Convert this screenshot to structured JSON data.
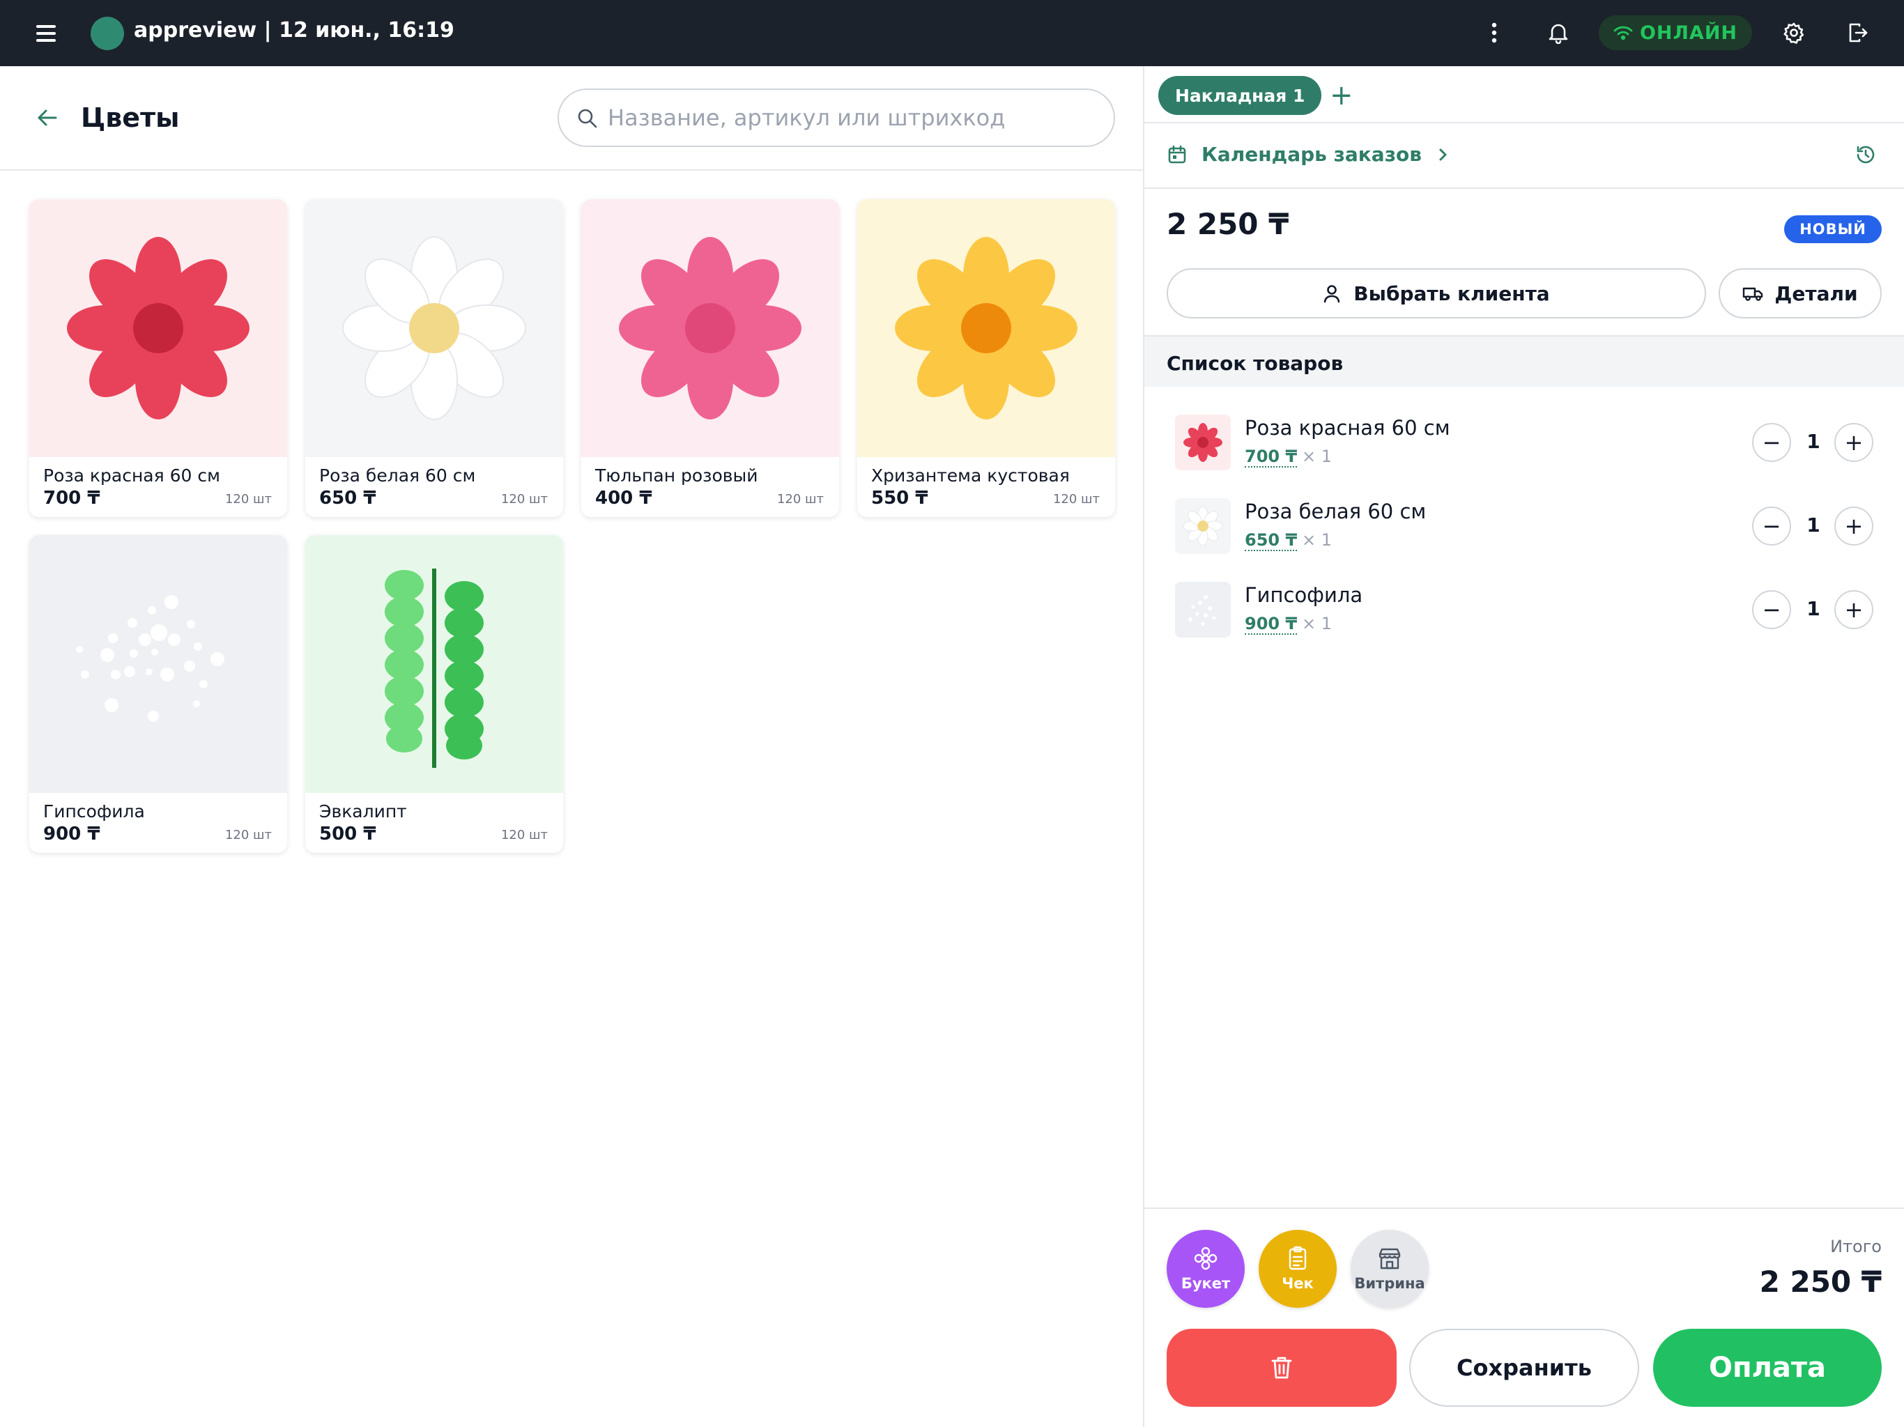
{
  "topbar": {
    "app_title": "appreview | 12 июн., 16:19",
    "online_label": "ОНЛАЙН",
    "icons": [
      "menu-icon",
      "more-vertical-icon",
      "bell-icon",
      "wifi-icon",
      "gear-icon",
      "logout-icon"
    ]
  },
  "catalog": {
    "title": "Цветы",
    "search_placeholder": "Название, артикул или штрихкод",
    "search_value": "",
    "products": [
      {
        "name": "Роза красная 60 см",
        "price": "700 ₸",
        "stock": "120 шт",
        "bg": "#fdecee",
        "petal": "#e8425a",
        "center": "#c5253b"
      },
      {
        "name": "Роза белая 60 см",
        "price": "650 ₸",
        "stock": "120 шт",
        "bg": "#f4f5f7",
        "petal": "#ffffff",
        "center": "#f2d98a"
      },
      {
        "name": "Тюльпан розовый",
        "price": "400 ₸",
        "stock": "120 шт",
        "bg": "#fdecf1",
        "petal": "#ef6392",
        "center": "#e0487a"
      },
      {
        "name": "Хризантема кустовая",
        "price": "550 ₸",
        "stock": "120 шт",
        "bg": "#fdf6d8",
        "petal": "#fcc844",
        "center": "#ee8a0b"
      },
      {
        "name": "Гипсофила",
        "price": "900 ₸",
        "stock": "120 шт",
        "bg": "#eef0f4"
      },
      {
        "name": "Эвкалипт",
        "price": "500 ₸",
        "stock": "120 шт",
        "bg": "#e7f8ea"
      }
    ]
  },
  "order": {
    "tab_label": "Накладная 1",
    "calendar_label": "Календарь заказов",
    "total": "2 250 ₸",
    "status": "НОВЫЙ",
    "client_button": "Выбрать клиента",
    "details_button": "Детали",
    "list_title": "Список товаров",
    "items": [
      {
        "name": "Роза красная 60 см",
        "price": "700 ₸",
        "multiplier": "× 1",
        "qty": "1"
      },
      {
        "name": "Роза белая 60 см",
        "price": "650 ₸",
        "multiplier": "× 1",
        "qty": "1"
      },
      {
        "name": "Гипсофила",
        "price": "900 ₸",
        "multiplier": "× 1",
        "qty": "1"
      }
    ],
    "actions": {
      "bouquet": "Букет",
      "check": "Чек",
      "showcase": "Витрина"
    },
    "itogo_label": "Итого",
    "itogo_value": "2 250 ₸",
    "save_label": "Сохранить",
    "pay_label": "Оплата"
  },
  "colors": {
    "accent": "#2f7d68",
    "danger": "#f75252",
    "pay": "#21c163",
    "badge": "#2563eb"
  }
}
